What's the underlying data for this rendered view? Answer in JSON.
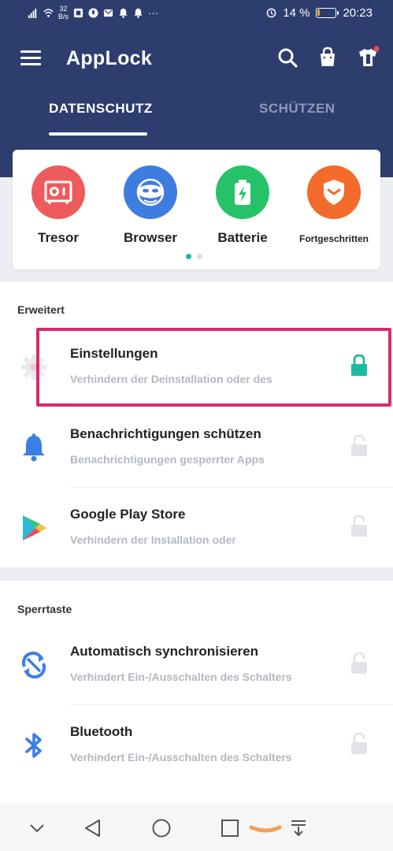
{
  "status_bar": {
    "net_speed_value": "32",
    "net_speed_unit": "B/s",
    "more": "···",
    "battery_percent": "14 %",
    "time": "20:23",
    "battery_level": 0.14,
    "battery_color": "#f0a23b"
  },
  "header": {
    "title": "AppLock",
    "background": "#2d3d6d",
    "icons": [
      "search-icon",
      "shopping-bag-icon",
      "theme-icon"
    ]
  },
  "tabs": [
    {
      "label": "DATENSCHUTZ",
      "active": true
    },
    {
      "label": "SCHÜTZEN",
      "active": false
    }
  ],
  "quick_actions": {
    "items": [
      {
        "label": "Tresor",
        "icon": "safe-icon",
        "color": "#ee5a5c"
      },
      {
        "label": "Browser",
        "icon": "mask-icon",
        "color": "#3f7ce0"
      },
      {
        "label": "Batterie",
        "icon": "battery-charging-icon",
        "color": "#26c26a"
      },
      {
        "label": "Fortgeschritten",
        "icon": "shield-icon",
        "color": "#f26b2a"
      }
    ],
    "page_index": 0,
    "page_count": 2
  },
  "sections": [
    {
      "title": "Erweitert",
      "rows": [
        {
          "title": "Einstellungen",
          "subtitle": "Verhindern der Deinstallation oder des",
          "icon": "settings-gear-icon",
          "locked": true
        },
        {
          "title": "Benachrichtigungen schützen",
          "subtitle": "Benachrichtigungen gesperrter Apps",
          "icon": "bell-icon",
          "locked": false
        },
        {
          "title": "Google Play Store",
          "subtitle": "Verhindern der Installation oder",
          "icon": "play-store-icon",
          "locked": false
        }
      ]
    },
    {
      "title": "Sperrtaste",
      "rows": [
        {
          "title": "Automatisch synchronisieren",
          "subtitle": "Verhindert Ein-/Ausschalten des Schalters",
          "icon": "sync-icon",
          "locked": false
        },
        {
          "title": "Bluetooth",
          "subtitle": "Verhindert Ein-/Ausschalten des Schalters",
          "icon": "bluetooth-icon",
          "locked": false
        }
      ]
    }
  ],
  "colors": {
    "accent": "#1eb9a4",
    "highlight": "#d62b6e",
    "lock_inactive": "#e3e4e8"
  },
  "nav_bar": {
    "buttons": [
      "collapse-icon",
      "back-icon",
      "home-icon",
      "recents-icon",
      "notification-pull-icon"
    ]
  }
}
